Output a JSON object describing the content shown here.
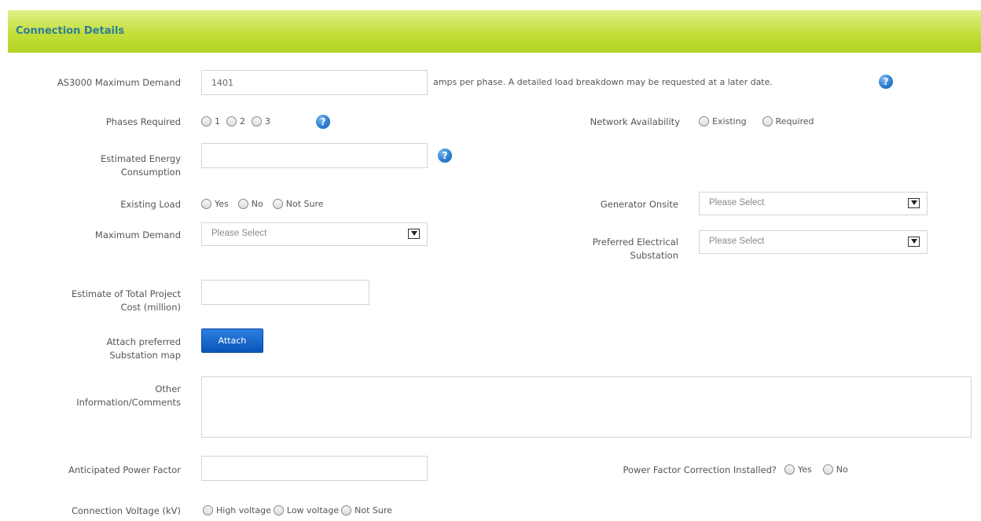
{
  "header": {
    "title": "Connection Details"
  },
  "as3000": {
    "label": "AS3000 Maximum Demand",
    "value": "1401",
    "note": "amps per phase. A detailed load breakdown may be requested at a later date."
  },
  "phases": {
    "label": "Phases Required",
    "options": [
      "1",
      "2",
      "3"
    ]
  },
  "network": {
    "label": "Network Availability",
    "options": [
      "Existing",
      "Required"
    ]
  },
  "energy": {
    "label_line1": "Estimated Energy",
    "label_line2": "Consumption",
    "value": ""
  },
  "existing_load": {
    "label": "Existing Load",
    "options": [
      "Yes",
      "No",
      "Not Sure"
    ]
  },
  "generator": {
    "label": "Generator Onsite",
    "selected": "Please Select"
  },
  "max_demand": {
    "label": "Maximum Demand",
    "selected": "Please Select"
  },
  "substation": {
    "label_line1": "Preferred Electrical",
    "label_line2": "Substation",
    "selected": "Please Select"
  },
  "project_cost": {
    "label_line1": "Estimate of Total Project",
    "label_line2": "Cost (million)",
    "value": ""
  },
  "attach": {
    "label_line1": "Attach preferred",
    "label_line2": "Substation map",
    "button": "Attach"
  },
  "comments": {
    "label_line1": "Other",
    "label_line2": "Information/Comments",
    "value": ""
  },
  "power_factor": {
    "label": "Anticipated Power Factor",
    "value": ""
  },
  "pf_correction": {
    "label": "Power Factor Correction Installed?",
    "options": [
      "Yes",
      "No"
    ]
  },
  "voltage": {
    "label": "Connection Voltage (kV)",
    "options": [
      "High voltage",
      "Low voltage",
      "Not Sure"
    ]
  },
  "icons": {
    "help": "help-icon",
    "dropdown": "chevron-down-icon"
  },
  "colors": {
    "header_green": "#c3df3a",
    "title_blue": "#2e7c99",
    "button_blue": "#1a66cc"
  }
}
